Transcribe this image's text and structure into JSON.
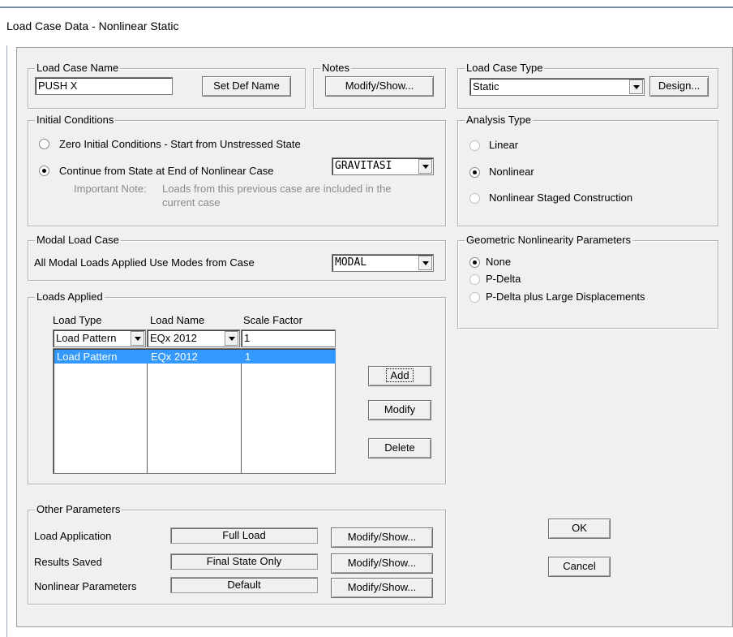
{
  "window": {
    "title": "Load Case Data - Nonlinear Static"
  },
  "load_case_name": {
    "group": "Load Case Name",
    "value": "PUSH X",
    "set_def_button": "Set Def Name"
  },
  "notes": {
    "group": "Notes",
    "button": "Modify/Show..."
  },
  "load_case_type": {
    "group": "Load Case Type",
    "selected": "Static",
    "design_button": "Design..."
  },
  "initial_conditions": {
    "group": "Initial Conditions",
    "option_zero": "Zero Initial Conditions - Start from Unstressed State",
    "option_continue": "Continue from State at End of Nonlinear Case",
    "continue_case": "GRAVITASI",
    "note_label": "Important Note:",
    "note_line1": "Loads from this previous case are included in the",
    "note_line2": "current case",
    "selected": "continue"
  },
  "analysis_type": {
    "group": "Analysis Type",
    "options": [
      "Linear",
      "Nonlinear",
      "Nonlinear Staged Construction"
    ],
    "selected": "Nonlinear"
  },
  "modal_load_case": {
    "group": "Modal Load Case",
    "label": "All Modal Loads Applied Use Modes from Case",
    "selected": "MODAL"
  },
  "geometric_nonlinearity": {
    "group": "Geometric Nonlinearity Parameters",
    "options": [
      "None",
      "P-Delta",
      "P-Delta plus Large Displacements"
    ],
    "selected": "None"
  },
  "loads_applied": {
    "group": "Loads Applied",
    "headers": [
      "Load Type",
      "Load Name",
      "Scale Factor"
    ],
    "edit_row": {
      "load_type": "Load Pattern",
      "load_name": "EQx 2012",
      "scale_factor": "1"
    },
    "rows": [
      {
        "load_type": "Load Pattern",
        "load_name": "EQx 2012",
        "scale_factor": "1"
      }
    ],
    "buttons": {
      "add": "Add",
      "modify": "Modify",
      "delete": "Delete"
    }
  },
  "other_parameters": {
    "group": "Other Parameters",
    "rows": [
      {
        "label": "Load Application",
        "value": "Full Load",
        "button": "Modify/Show..."
      },
      {
        "label": "Results Saved",
        "value": "Final State Only",
        "button": "Modify/Show..."
      },
      {
        "label": "Nonlinear Parameters",
        "value": "Default",
        "button": "Modify/Show..."
      }
    ]
  },
  "dialog_buttons": {
    "ok": "OK",
    "cancel": "Cancel"
  },
  "colors": {
    "selection": "#3399ff",
    "dialog_bg": "#f0f0f0"
  }
}
